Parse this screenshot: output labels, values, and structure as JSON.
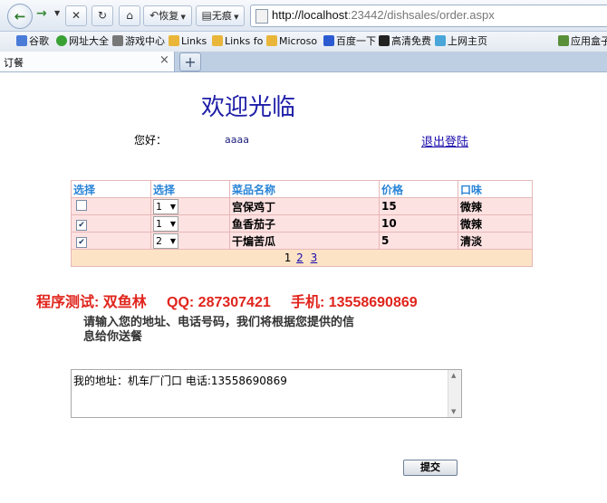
{
  "browser": {
    "restore_label": "恢复",
    "inprivate_label": "无痕",
    "url_host": "http://localhost",
    "url_rest": ":23442/dishsales/order.aspx",
    "bookmarks": [
      {
        "label": "谷歌",
        "icon": "google-icon"
      },
      {
        "label": "网址大全",
        "icon": "ie-icon"
      },
      {
        "label": "游戏中心",
        "icon": "gamepad-icon"
      },
      {
        "label": "Links",
        "icon": "folder-icon"
      },
      {
        "label": "Links fo",
        "icon": "folder-icon"
      },
      {
        "label": "Microso",
        "icon": "folder-icon"
      },
      {
        "label": "百度一下",
        "icon": "baidu-icon"
      },
      {
        "label": "高清免费",
        "icon": "film-icon"
      },
      {
        "label": "上网主页",
        "icon": "home-icon"
      },
      {
        "label": "应用盒子",
        "icon": "box-icon"
      }
    ],
    "tab_title": "订餐"
  },
  "page": {
    "welcome": "欢迎光临",
    "greeting": "您好：",
    "username": "aaaa",
    "logout": "退出登陆",
    "table": {
      "headers": [
        "选择",
        "选择",
        "菜品名称",
        "价格",
        "口味"
      ],
      "rows": [
        {
          "checked": false,
          "qty": "1",
          "name": "宫保鸡丁",
          "price": "15",
          "taste": "微辣"
        },
        {
          "checked": true,
          "qty": "1",
          "name": "鱼香茄子",
          "price": "10",
          "taste": "微辣"
        },
        {
          "checked": true,
          "qty": "2",
          "name": "干煸苦瓜",
          "price": "5",
          "taste": "清淡"
        }
      ],
      "pages": [
        "1",
        "2",
        "3"
      ]
    },
    "contact": "程序测试: 双鱼林     QQ: 287307421     手机: 13558690869",
    "instruction": "请输入您的地址、电话号码，我们将根据您提供的信息给你送餐",
    "address_value": "我的地址：机车厂门口  电话:13558690869",
    "submit": "提交"
  },
  "colors": {
    "welcome": "#1e1ea8",
    "header_text": "#2a84d6",
    "row_bg": "#fde2e2",
    "pager_bg": "#fde3c6",
    "contact": "#e0241c"
  }
}
